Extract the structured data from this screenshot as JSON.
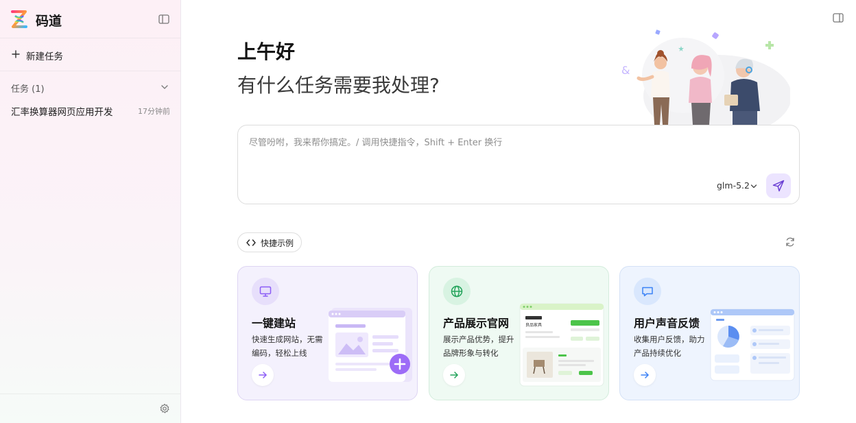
{
  "sidebar": {
    "brand": "码道",
    "new_task_label": "新建任务",
    "task_section_label": "任务 (1)",
    "tasks": [
      {
        "name": "汇率换算器网页应用开发",
        "time": "17分钟前"
      }
    ]
  },
  "main": {
    "greeting": "上午好",
    "subtitle": "有什么任务需要我处理?",
    "input": {
      "placeholder": "尽管吩咐，我来帮你搞定。/ 调用快捷指令，Shift + Enter 换行",
      "value": ""
    },
    "model": "glm-5.2",
    "quick_examples_label": "快捷示例",
    "cards": [
      {
        "title": "一键建站",
        "desc": "快速生成网站，无需编码，轻松上线",
        "accent": "#8b5cf6"
      },
      {
        "title": "产品展示官网",
        "desc": "展示产品优势，提升品牌形象与转化",
        "accent": "#22a35a"
      },
      {
        "title": "用户声音反馈",
        "desc": "收集用户反馈，助力产品持续优化",
        "accent": "#3b82f6"
      }
    ],
    "card2_mock": {
      "brand": "良品家具"
    }
  },
  "colors": {
    "accent_purple": "#8b5cf6",
    "accent_green": "#22a35a",
    "accent_blue": "#3b82f6"
  }
}
